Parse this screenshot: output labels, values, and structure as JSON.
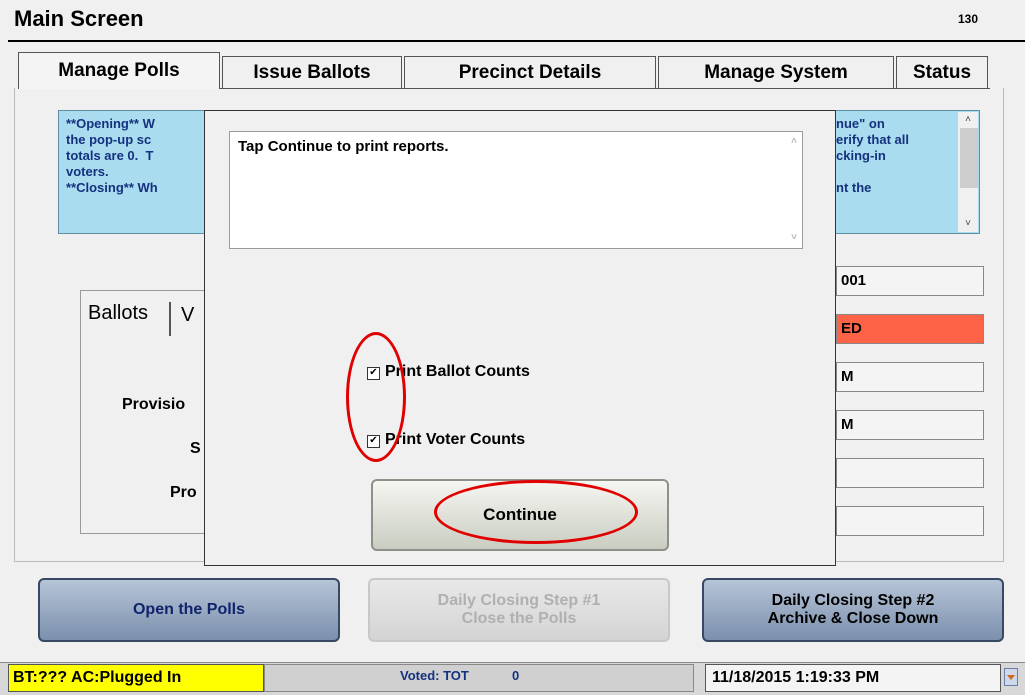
{
  "header": {
    "title": "Main Screen",
    "screen_number": "130"
  },
  "tabs": [
    {
      "label": "Manage Polls",
      "active": true
    },
    {
      "label": "Issue Ballots",
      "active": false
    },
    {
      "label": "Precinct Details",
      "active": false
    },
    {
      "label": "Manage System",
      "active": false
    },
    {
      "label": "Status",
      "active": false
    }
  ],
  "info": {
    "left_text": "**Opening** W\nthe pop-up sc\ntotals are 0.  T\nvoters.\n**Closing** Wh",
    "right_text": "nue\" on\nerify that all\ncking-in\n\nnt the"
  },
  "panel": {
    "tab_ballots": "Ballots",
    "tab_next": "V",
    "rows": [
      "Provisio",
      "S",
      "Pro"
    ]
  },
  "fields": [
    "001",
    "ED",
    "M",
    "M",
    "",
    ""
  ],
  "buttons": {
    "open_polls": "Open the Polls",
    "close_polls_line1": "Daily Closing Step #1",
    "close_polls_line2": "Close the Polls",
    "archive_line1": "Daily Closing Step #2",
    "archive_line2": "Archive & Close Down"
  },
  "dialog": {
    "message": "Tap Continue to print reports.",
    "checkbox_ballot": {
      "label": "Print Ballot Counts",
      "checked": true
    },
    "checkbox_voter": {
      "label": "Print Voter Counts",
      "checked": true
    },
    "continue_label": "Continue"
  },
  "status_bar": {
    "bt_status": "BT:??? AC:Plugged In",
    "voted_label": "Voted:  TOT",
    "voted_value": "0",
    "datetime": "11/18/2015 1:19:33 PM"
  },
  "colors": {
    "info_bg": "#aadcf0",
    "info_text": "#15317e",
    "status_yellow": "#ffff00",
    "alert_red": "#ff6347",
    "annotation_red": "#e00000"
  }
}
